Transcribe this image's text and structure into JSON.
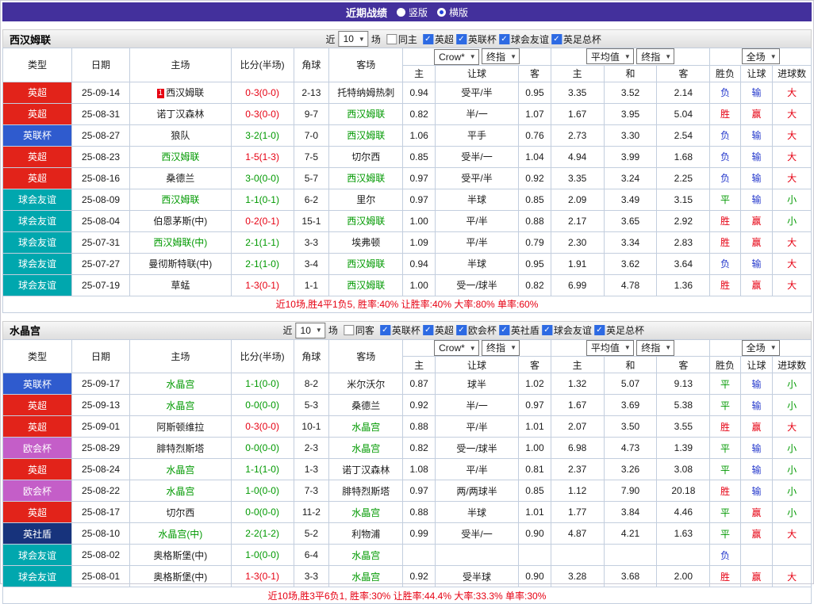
{
  "titlebar": {
    "title": "近期战绩",
    "vertical_label": "竖版",
    "horizontal_label": "横版",
    "selected_layout": "横版"
  },
  "ui": {
    "near_label": "近",
    "games_label": "场",
    "odds_source": "Crow*",
    "stage_label": "终指",
    "avg_label": "平均值",
    "scope_label": "全场",
    "icons": {
      "check": "✓",
      "dropdown": "▼"
    }
  },
  "columns": {
    "type": "类型",
    "date": "日期",
    "home": "主场",
    "score": "比分(半场)",
    "corner": "角球",
    "away": "客场",
    "odds_home": "主",
    "odds_handicap": "让球",
    "odds_away": "客",
    "avg_home": "主",
    "avg_draw": "和",
    "avg_away": "客",
    "result": "胜负",
    "handicap_result": "让球",
    "goals": "进球数"
  },
  "colors": {
    "titlebar": "#43309c",
    "red": "#e60012",
    "green": "#009900",
    "blue": "#2438cc",
    "border": "#c3cede",
    "check": "#2d6ae3"
  },
  "league_colors": {
    "英超": "#e2231a",
    "英联杯": "#2f5bce",
    "球会友谊": "#00a7ae",
    "欧会杯": "#c45ec8",
    "英社盾": "#17337c"
  },
  "value_colors": {
    "胜": "red",
    "平": "green",
    "负": "blue",
    "赢": "red",
    "输": "blue",
    "大": "red",
    "小": "green"
  },
  "sections": [
    {
      "team": "西汉姆联",
      "filter": {
        "count": "10",
        "same_label": "同主",
        "leagues": [
          "英超",
          "英联杯",
          "球会友谊",
          "英足总杯"
        ]
      },
      "summary": "近10场,胜4平1负5, 胜率:40% 让胜率:40% 大率:80% 单率:60%",
      "rows": [
        {
          "league": "英超",
          "date": "25-09-14",
          "home": "西汉姆联",
          "home_color": "black",
          "home_rank": "1",
          "score": "0-3(0-0)",
          "score_color": "red",
          "corner": "2-13",
          "away": "托特纳姆热刺",
          "away_color": "black",
          "crown_home": "0.94",
          "handicap": "受平/半",
          "crown_away": "0.95",
          "avg_home": "3.35",
          "avg_draw": "3.52",
          "avg_away": "2.14",
          "result": "负",
          "handicap_result": "输",
          "goals_result": "大"
        },
        {
          "league": "英超",
          "date": "25-08-31",
          "home": "诺丁汉森林",
          "home_color": "black",
          "score": "0-3(0-0)",
          "score_color": "red",
          "corner": "9-7",
          "away": "西汉姆联",
          "away_color": "green",
          "crown_home": "0.82",
          "handicap": "半/一",
          "crown_away": "1.07",
          "avg_home": "1.67",
          "avg_draw": "3.95",
          "avg_away": "5.04",
          "result": "胜",
          "handicap_result": "赢",
          "goals_result": "大"
        },
        {
          "league": "英联杯",
          "date": "25-08-27",
          "home": "狼队",
          "home_color": "black",
          "score": "3-2(1-0)",
          "score_color": "green",
          "corner": "7-0",
          "away": "西汉姆联",
          "away_color": "green",
          "crown_home": "1.06",
          "handicap": "平手",
          "crown_away": "0.76",
          "avg_home": "2.73",
          "avg_draw": "3.30",
          "avg_away": "2.54",
          "result": "负",
          "handicap_result": "输",
          "goals_result": "大"
        },
        {
          "league": "英超",
          "date": "25-08-23",
          "home": "西汉姆联",
          "home_color": "green",
          "score": "1-5(1-3)",
          "score_color": "red",
          "corner": "7-5",
          "away": "切尔西",
          "away_color": "black",
          "crown_home": "0.85",
          "handicap": "受半/一",
          "crown_away": "1.04",
          "avg_home": "4.94",
          "avg_draw": "3.99",
          "avg_away": "1.68",
          "result": "负",
          "handicap_result": "输",
          "goals_result": "大"
        },
        {
          "league": "英超",
          "date": "25-08-16",
          "home": "桑德兰",
          "home_color": "black",
          "score": "3-0(0-0)",
          "score_color": "green",
          "corner": "5-7",
          "away": "西汉姆联",
          "away_color": "green",
          "crown_home": "0.97",
          "handicap": "受平/半",
          "crown_away": "0.92",
          "avg_home": "3.35",
          "avg_draw": "3.24",
          "avg_away": "2.25",
          "result": "负",
          "handicap_result": "输",
          "goals_result": "大"
        },
        {
          "league": "球会友谊",
          "date": "25-08-09",
          "home": "西汉姆联",
          "home_color": "green",
          "score": "1-1(0-1)",
          "score_color": "green",
          "corner": "6-2",
          "away": "里尔",
          "away_color": "black",
          "crown_home": "0.97",
          "handicap": "半球",
          "crown_away": "0.85",
          "avg_home": "2.09",
          "avg_draw": "3.49",
          "avg_away": "3.15",
          "result": "平",
          "handicap_result": "输",
          "goals_result": "小"
        },
        {
          "league": "球会友谊",
          "date": "25-08-04",
          "home": "伯恩茅斯(中)",
          "home_color": "black",
          "score": "0-2(0-1)",
          "score_color": "red",
          "corner": "15-1",
          "away": "西汉姆联",
          "away_color": "green",
          "crown_home": "1.00",
          "handicap": "平/半",
          "crown_away": "0.88",
          "avg_home": "2.17",
          "avg_draw": "3.65",
          "avg_away": "2.92",
          "result": "胜",
          "handicap_result": "赢",
          "goals_result": "小"
        },
        {
          "league": "球会友谊",
          "date": "25-07-31",
          "home": "西汉姆联(中)",
          "home_color": "green",
          "score": "2-1(1-1)",
          "score_color": "green",
          "corner": "3-3",
          "away": "埃弗顿",
          "away_color": "black",
          "crown_home": "1.09",
          "handicap": "平/半",
          "crown_away": "0.79",
          "avg_home": "2.30",
          "avg_draw": "3.34",
          "avg_away": "2.83",
          "result": "胜",
          "handicap_result": "赢",
          "goals_result": "大"
        },
        {
          "league": "球会友谊",
          "date": "25-07-27",
          "home": "曼彻斯特联(中)",
          "home_color": "black",
          "score": "2-1(1-0)",
          "score_color": "green",
          "corner": "3-4",
          "away": "西汉姆联",
          "away_color": "green",
          "crown_home": "0.94",
          "handicap": "半球",
          "crown_away": "0.95",
          "avg_home": "1.91",
          "avg_draw": "3.62",
          "avg_away": "3.64",
          "result": "负",
          "handicap_result": "输",
          "goals_result": "大"
        },
        {
          "league": "球会友谊",
          "date": "25-07-19",
          "home": "草蜢",
          "home_color": "black",
          "score": "1-3(0-1)",
          "score_color": "red",
          "corner": "1-1",
          "away": "西汉姆联",
          "away_color": "green",
          "crown_home": "1.00",
          "handicap": "受一/球半",
          "crown_away": "0.82",
          "avg_home": "6.99",
          "avg_draw": "4.78",
          "avg_away": "1.36",
          "result": "胜",
          "handicap_result": "赢",
          "goals_result": "大"
        }
      ]
    },
    {
      "team": "水晶宫",
      "filter": {
        "count": "10",
        "same_label": "同客",
        "leagues": [
          "英联杯",
          "英超",
          "欧会杯",
          "英社盾",
          "球会友谊",
          "英足总杯"
        ]
      },
      "summary": "近10场,胜3平6负1, 胜率:30% 让胜率:44.4% 大率:33.3% 单率:30%",
      "rows": [
        {
          "league": "英联杯",
          "date": "25-09-17",
          "home": "水晶宫",
          "home_color": "green",
          "score": "1-1(0-0)",
          "score_color": "green",
          "corner": "8-2",
          "away": "米尔沃尔",
          "away_color": "black",
          "crown_home": "0.87",
          "handicap": "球半",
          "crown_away": "1.02",
          "avg_home": "1.32",
          "avg_draw": "5.07",
          "avg_away": "9.13",
          "result": "平",
          "handicap_result": "输",
          "goals_result": "小"
        },
        {
          "league": "英超",
          "date": "25-09-13",
          "home": "水晶宫",
          "home_color": "green",
          "score": "0-0(0-0)",
          "score_color": "green",
          "corner": "5-3",
          "away": "桑德兰",
          "away_color": "black",
          "crown_home": "0.92",
          "handicap": "半/一",
          "crown_away": "0.97",
          "avg_home": "1.67",
          "avg_draw": "3.69",
          "avg_away": "5.38",
          "result": "平",
          "handicap_result": "输",
          "goals_result": "小"
        },
        {
          "league": "英超",
          "date": "25-09-01",
          "home": "阿斯顿维拉",
          "home_color": "black",
          "score": "0-3(0-0)",
          "score_color": "red",
          "corner": "10-1",
          "away": "水晶宫",
          "away_color": "green",
          "crown_home": "0.88",
          "handicap": "平/半",
          "crown_away": "1.01",
          "avg_home": "2.07",
          "avg_draw": "3.50",
          "avg_away": "3.55",
          "result": "胜",
          "handicap_result": "赢",
          "goals_result": "大"
        },
        {
          "league": "欧会杯",
          "date": "25-08-29",
          "home": "腓特烈斯塔",
          "home_color": "black",
          "score": "0-0(0-0)",
          "score_color": "green",
          "corner": "2-3",
          "away": "水晶宫",
          "away_color": "green",
          "crown_home": "0.82",
          "handicap": "受一/球半",
          "crown_away": "1.00",
          "avg_home": "6.98",
          "avg_draw": "4.73",
          "avg_away": "1.39",
          "result": "平",
          "handicap_result": "输",
          "goals_result": "小"
        },
        {
          "league": "英超",
          "date": "25-08-24",
          "home": "水晶宫",
          "home_color": "green",
          "score": "1-1(1-0)",
          "score_color": "green",
          "corner": "1-3",
          "away": "诺丁汉森林",
          "away_color": "black",
          "crown_home": "1.08",
          "handicap": "平/半",
          "crown_away": "0.81",
          "avg_home": "2.37",
          "avg_draw": "3.26",
          "avg_away": "3.08",
          "result": "平",
          "handicap_result": "输",
          "goals_result": "小"
        },
        {
          "league": "欧会杯",
          "date": "25-08-22",
          "home": "水晶宫",
          "home_color": "green",
          "score": "1-0(0-0)",
          "score_color": "green",
          "corner": "7-3",
          "away": "腓特烈斯塔",
          "away_color": "black",
          "crown_home": "0.97",
          "handicap": "两/两球半",
          "crown_away": "0.85",
          "avg_home": "1.12",
          "avg_draw": "7.90",
          "avg_away": "20.18",
          "result": "胜",
          "handicap_result": "输",
          "goals_result": "小"
        },
        {
          "league": "英超",
          "date": "25-08-17",
          "home": "切尔西",
          "home_color": "black",
          "score": "0-0(0-0)",
          "score_color": "green",
          "corner": "11-2",
          "away": "水晶宫",
          "away_color": "green",
          "crown_home": "0.88",
          "handicap": "半球",
          "crown_away": "1.01",
          "avg_home": "1.77",
          "avg_draw": "3.84",
          "avg_away": "4.46",
          "result": "平",
          "handicap_result": "赢",
          "goals_result": "小"
        },
        {
          "league": "英社盾",
          "date": "25-08-10",
          "home": "水晶宫(中)",
          "home_color": "green",
          "score": "2-2(1-2)",
          "score_color": "green",
          "corner": "5-2",
          "away": "利物浦",
          "away_color": "black",
          "crown_home": "0.99",
          "handicap": "受半/一",
          "crown_away": "0.90",
          "avg_home": "4.87",
          "avg_draw": "4.21",
          "avg_away": "1.63",
          "result": "平",
          "handicap_result": "赢",
          "goals_result": "大"
        },
        {
          "league": "球会友谊",
          "date": "25-08-02",
          "home": "奥格斯堡(中)",
          "home_color": "black",
          "score": "1-0(0-0)",
          "score_color": "green",
          "corner": "6-4",
          "away": "水晶宫",
          "away_color": "green",
          "crown_home": "",
          "handicap": "",
          "crown_away": "",
          "avg_home": "",
          "avg_draw": "",
          "avg_away": "",
          "result": "负",
          "handicap_result": "",
          "goals_result": ""
        },
        {
          "league": "球会友谊",
          "date": "25-08-01",
          "home": "奥格斯堡(中)",
          "home_color": "black",
          "score": "1-3(0-1)",
          "score_color": "red",
          "corner": "3-3",
          "away": "水晶宫",
          "away_color": "green",
          "crown_home": "0.92",
          "handicap": "受半球",
          "crown_away": "0.90",
          "avg_home": "3.28",
          "avg_draw": "3.68",
          "avg_away": "2.00",
          "result": "胜",
          "handicap_result": "赢",
          "goals_result": "大"
        }
      ]
    }
  ]
}
